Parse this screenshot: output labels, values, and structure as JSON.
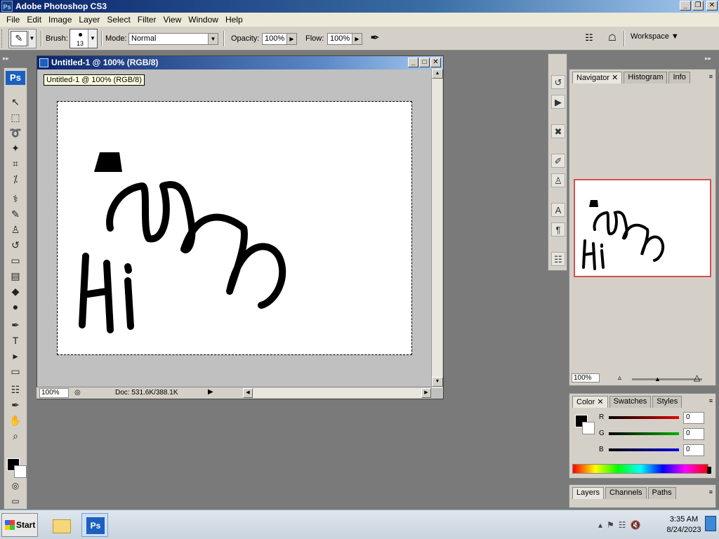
{
  "app": {
    "title": "Adobe Photoshop CS3",
    "icon_text": "Ps"
  },
  "menu": [
    "File",
    "Edit",
    "Image",
    "Layer",
    "Select",
    "Filter",
    "View",
    "Window",
    "Help"
  ],
  "options": {
    "brush_label": "Brush:",
    "brush_size": "13",
    "mode_label": "Mode:",
    "mode_value": "Normal",
    "opacity_label": "Opacity:",
    "opacity_value": "100%",
    "flow_label": "Flow:",
    "flow_value": "100%",
    "workspace_label": "Workspace ▼"
  },
  "toolbox": {
    "logo": "Ps",
    "tools": [
      {
        "name": "move-tool",
        "glyph": "↖"
      },
      {
        "name": "marquee-tool",
        "glyph": "⬚"
      },
      {
        "name": "lasso-tool",
        "glyph": "➰"
      },
      {
        "name": "magic-wand-tool",
        "glyph": "✦"
      },
      {
        "name": "crop-tool",
        "glyph": "⌗"
      },
      {
        "name": "eyedropper-slice-tool",
        "glyph": "⁒"
      },
      {
        "name": "healing-brush-tool",
        "glyph": "⚕"
      },
      {
        "name": "brush-tool",
        "glyph": "✎"
      },
      {
        "name": "clone-stamp-tool",
        "glyph": "♙"
      },
      {
        "name": "history-brush-tool",
        "glyph": "↺"
      },
      {
        "name": "eraser-tool",
        "glyph": "▭"
      },
      {
        "name": "gradient-tool",
        "glyph": "▤"
      },
      {
        "name": "blur-tool",
        "glyph": "◆"
      },
      {
        "name": "dodge-tool",
        "glyph": "●"
      },
      {
        "name": "pen-tool",
        "glyph": "✒"
      },
      {
        "name": "type-tool",
        "glyph": "T"
      },
      {
        "name": "path-selection-tool",
        "glyph": "▸"
      },
      {
        "name": "shape-tool",
        "glyph": "▭"
      },
      {
        "name": "notes-tool",
        "glyph": "☷"
      },
      {
        "name": "eyedropper-tool",
        "glyph": "✒"
      },
      {
        "name": "hand-tool",
        "glyph": "✋"
      },
      {
        "name": "zoom-tool",
        "glyph": "⌕"
      }
    ]
  },
  "document": {
    "title": "Untitled-1 @ 100% (RGB/8)",
    "tooltip": "Untitled-1 @ 100% (RGB/8)",
    "zoom": "100%",
    "doc_info": "Doc: 531.6K/388.1K"
  },
  "navigator_panel": {
    "tabs": [
      "Navigator",
      "Histogram",
      "Info"
    ],
    "zoom": "100%"
  },
  "color_panel": {
    "tabs": [
      "Color",
      "Swatches",
      "Styles"
    ],
    "channels": [
      {
        "label": "R",
        "value": "0",
        "color": "#e00000"
      },
      {
        "label": "G",
        "value": "0",
        "color": "#00b000"
      },
      {
        "label": "B",
        "value": "0",
        "color": "#0000e0"
      }
    ]
  },
  "layers_panel": {
    "tabs": [
      "Layers",
      "Channels",
      "Paths"
    ]
  },
  "taskbar": {
    "start_label": "Start",
    "time": "3:35 AM",
    "date": "8/24/2023",
    "ps_icon_text": "Ps"
  }
}
